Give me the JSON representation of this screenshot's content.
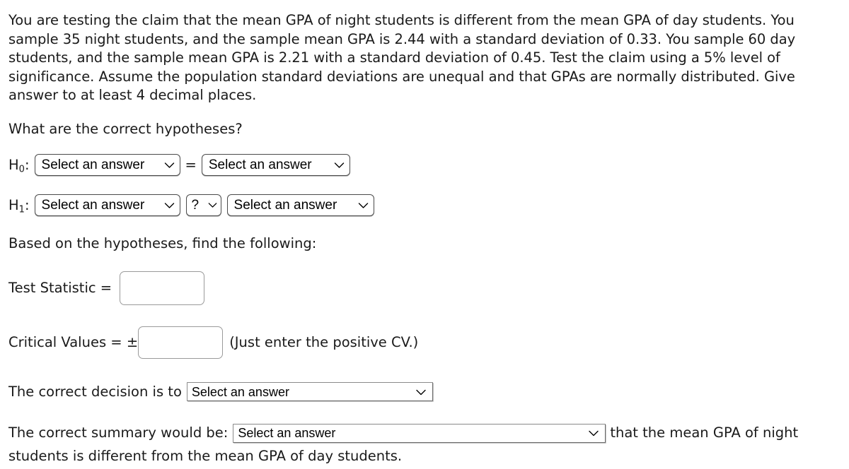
{
  "problem": {
    "statement": "You are testing the claim that the mean GPA of night students is different from the mean GPA of day students. You sample 35 night students, and the sample mean GPA is 2.44 with a standard deviation of 0.33. You sample 60 day students, and the sample mean GPA is 2.21 with a standard deviation of 0.45. Test the claim using a 5% level of significance. Assume the population standard deviations are unequal and that GPAs are normally distributed. Give answer to at least 4 decimal places.",
    "night_sample_size": 35,
    "night_mean_gpa": 2.44,
    "night_std_dev": 0.33,
    "day_sample_size": 60,
    "day_mean_gpa": 2.21,
    "day_std_dev": 0.45,
    "significance_level": "5%",
    "decimal_places": 4
  },
  "hypotheses": {
    "prompt": "What are the correct hypotheses?",
    "h0_label": "H",
    "h0_subscript": "0",
    "h0_colon": ":",
    "h0_left_value": "Select an answer",
    "h0_operator": "=",
    "h0_right_value": "Select an answer",
    "h1_label": "H",
    "h1_subscript": "1",
    "h1_colon": ":",
    "h1_left_value": "Select an answer",
    "h1_operator_value": "?",
    "h1_right_value": "Select an answer"
  },
  "findings": {
    "intro": "Based on the hypotheses, find the following:",
    "test_statistic_label": "Test Statistic =",
    "test_statistic_value": "",
    "critical_values_label": "Critical Values = ±",
    "critical_values_value": "",
    "critical_values_note": "(Just enter the positive CV.)"
  },
  "decision": {
    "prefix": "The correct decision is to",
    "value": "Select an answer"
  },
  "summary": {
    "prefix": "The correct summary would be:",
    "value": "Select an answer",
    "suffix": "that the mean GPA of night",
    "line2": "students is different from the mean GPA of day students."
  },
  "colors": {
    "page_background": "#ffffff",
    "text": "#1a1a1a",
    "control_border": "#4a4a4a",
    "input_border": "#9a9a9a"
  },
  "icons": {
    "chevron_down": "chevron-down-icon"
  }
}
